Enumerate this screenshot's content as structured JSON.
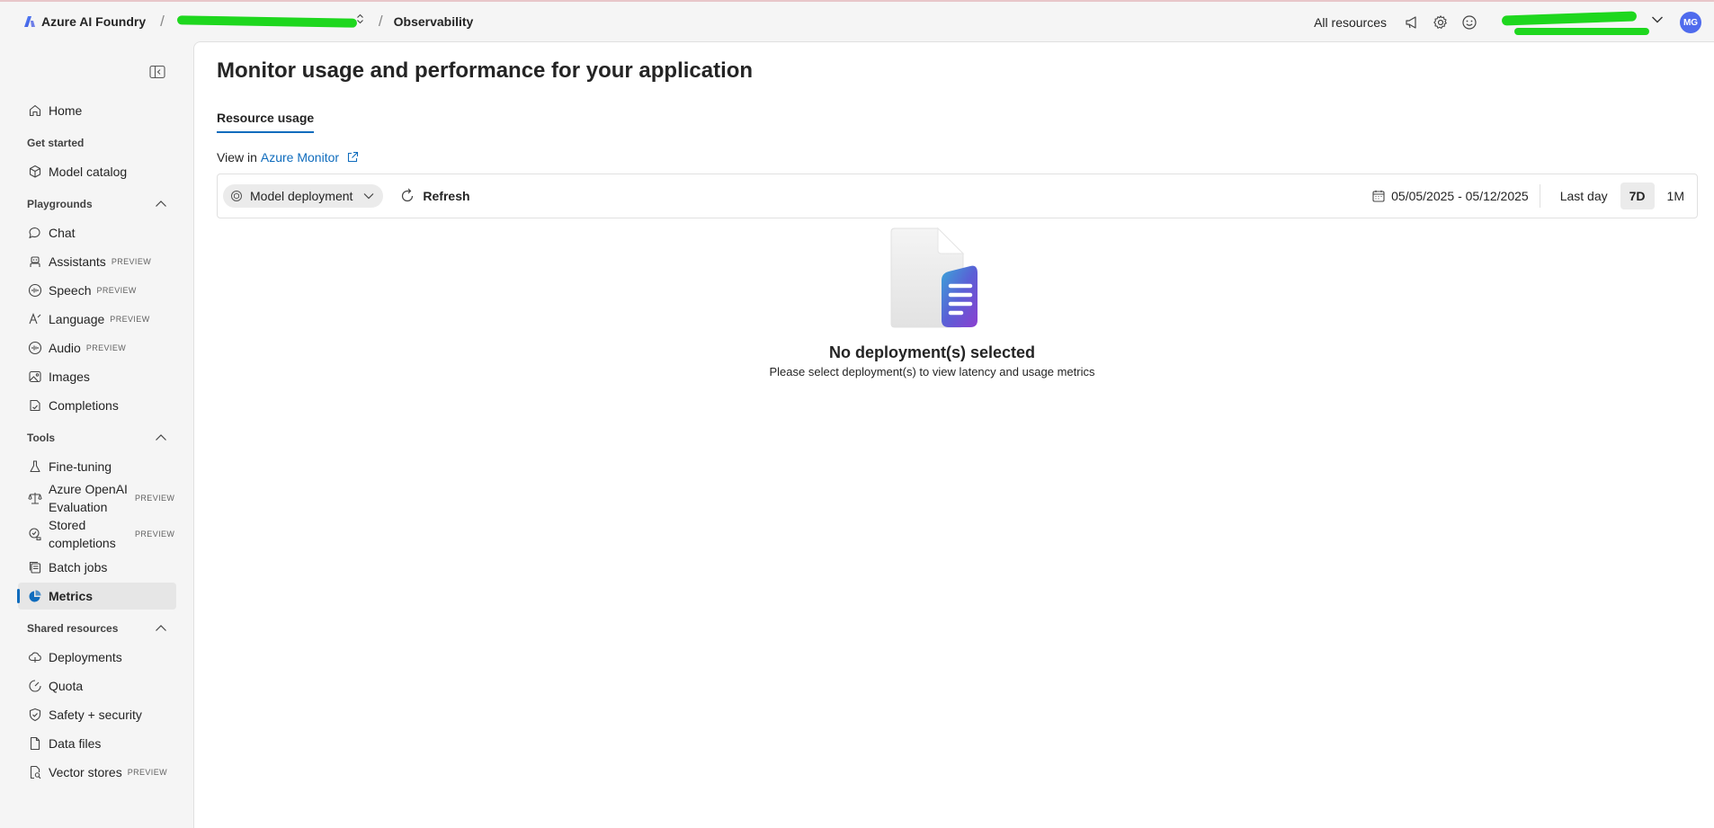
{
  "topbar": {
    "brand": "Azure AI Foundry",
    "page_crumb": "Observability",
    "all_resources": "All resources",
    "avatar_initials": "MG"
  },
  "sidebar": {
    "home": "Home",
    "get_started": "Get started",
    "model_catalog": "Model catalog",
    "playgrounds": "Playgrounds",
    "chat": "Chat",
    "assistants": "Assistants",
    "speech": "Speech",
    "language": "Language",
    "audio": "Audio",
    "images": "Images",
    "completions": "Completions",
    "tools": "Tools",
    "fine_tuning": "Fine-tuning",
    "evaluation": "Azure OpenAI Evaluation",
    "stored_completions": "Stored completions",
    "batch_jobs": "Batch jobs",
    "metrics": "Metrics",
    "shared_resources": "Shared resources",
    "deployments": "Deployments",
    "quota": "Quota",
    "safety": "Safety + security",
    "data_files": "Data files",
    "vector_stores": "Vector stores",
    "preview_badge": "PREVIEW"
  },
  "main": {
    "title": "Monitor usage and performance for your application",
    "tab": "Resource usage",
    "view_in": "View in",
    "azure_monitor": "Azure Monitor",
    "deployment_filter": "Model deployment",
    "refresh": "Refresh",
    "date_range": "05/05/2025 - 05/12/2025",
    "range_last_day": "Last day",
    "range_7d": "7D",
    "range_1m": "1M",
    "empty_title": "No deployment(s) selected",
    "empty_subtitle": "Please select deployment(s) to view latency and usage metrics"
  },
  "colors": {
    "accent": "#0f6cbd",
    "avatar": "#4f6bed",
    "redaction": "#1ed71e"
  }
}
